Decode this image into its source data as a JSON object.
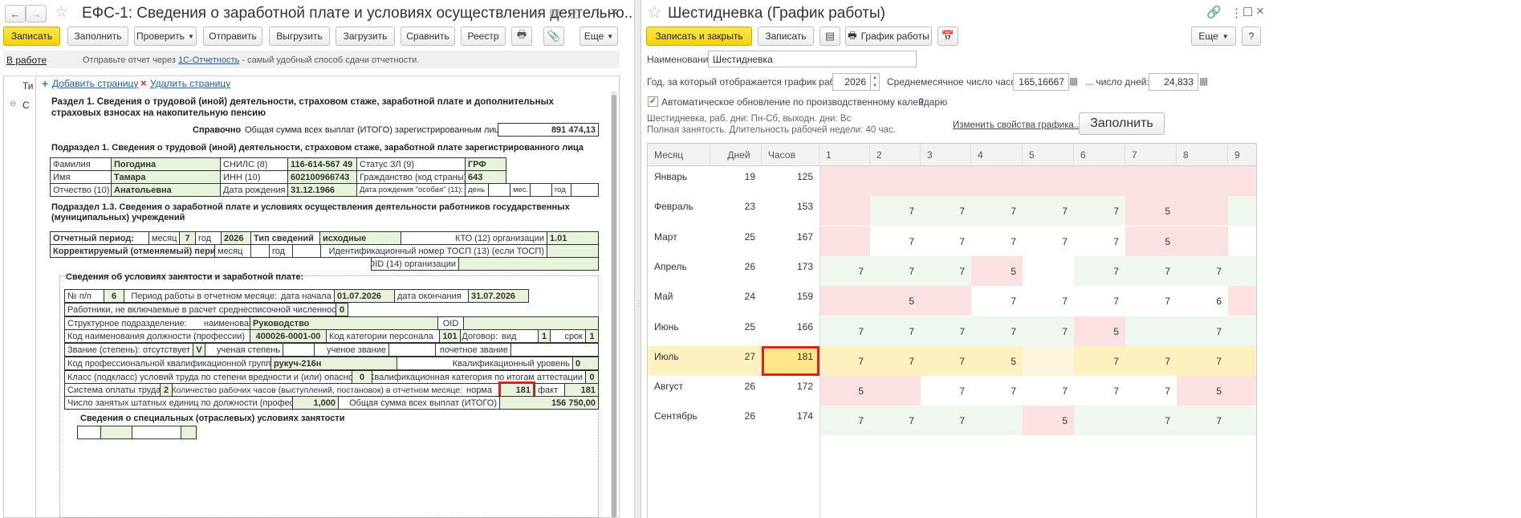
{
  "left": {
    "title": "ЕФС-1: Сведения о заработной плате и условиях осуществления деятельно...",
    "toolbar": {
      "save": "Записать",
      "fill": "Заполнить",
      "check": "Проверить",
      "send": "Отправить",
      "unload": "Выгрузить",
      "load": "Загрузить",
      "compare": "Сравнить",
      "registry": "Реестр",
      "more": "Еще"
    },
    "status": {
      "state": "В работе",
      "hint_pre": "Отправьте отчет через ",
      "hint_link": "1С-Отчетность",
      "hint_post": " - самый удобный способ сдачи отчетности."
    },
    "tree": {
      "t1": "Ти",
      "t2": "С"
    },
    "page_actions": {
      "add": "Добавить страницу",
      "remove": "Удалить страницу"
    },
    "form": {
      "section1": "Раздел 1. Сведения о трудовой (иной) деятельности, страховом стаже, заработной плате и дополнительных страховых взносах на накопительную пенсию",
      "ref": "Справочно",
      "total_label": "Общая сумма всех выплат (ИТОГО) зарегистрированным лицам",
      "total_value": "891 474,13",
      "sub1": "Подраздел 1. Сведения о трудовой (иной) деятельности, страховом стаже, заработной плате зарегистрированного лица",
      "surname_l": "Фамилия",
      "surname": "Погодина",
      "snils_l": "СНИЛС (8)",
      "snils": "116-614-567 49",
      "status_l": "Статус ЗЛ (9)",
      "status": "ГРФ",
      "name_l": "Имя",
      "name": "Тамара",
      "inn_l": "ИНН (10)",
      "inn": "602100966743",
      "citizen_l": "Гражданство (код страны)",
      "citizen": "643",
      "patr_l": "Отчество (10)",
      "patr": "Анатольевна",
      "dob_l": "Дата рождения",
      "dob": "31.12.1966",
      "dob_sp_l": "Дата рождения \"особая\" (11):",
      "day": "день",
      "mon": "мес.",
      "year": "год",
      "sub13": "Подраздел 1.3. Сведения о заработной плате и условиях осуществления деятельности работников государственных (муниципальных) учреждений",
      "period_l": "Отчетный период:",
      "month_l": "месяц",
      "month": "7",
      "year_l": "год",
      "year_v": "2026",
      "type_l": "Тип сведений",
      "type": "исходные",
      "kto_l": "КТО (12) организации",
      "kto": "1.01",
      "corr_l": "Корректируемый (отменяемый) период:",
      "corr_m": "месяц",
      "corr_y": "год",
      "tosp_l": "Идентификационный номер ТОСП (13) (если ТОСП)",
      "oid_l": "OID (14) организации",
      "cond_h": "Сведения об условиях занятости и заработной плате:",
      "np_l": "№ п/п",
      "np": "6",
      "work_l": "Период работы в отчетном месяце:",
      "start_l": "дата начала",
      "start": "01.07.2026",
      "end_l": "дата окончания",
      "end": "31.07.2026",
      "excl_l": "Работники, не включаемые в расчет среднесписочной численности",
      "excl": "0",
      "dept_l": "Структурное подразделение:",
      "dept_n": "наименование",
      "dept": "Руководство",
      "oid2": "OID",
      "pos_l": "Код наименования должности (профессии)",
      "pos": "400026-0001-00",
      "cat_l": "Код категории персонала",
      "cat": "101",
      "contract_l": "Договор:",
      "kind_l": "вид",
      "kind": "1",
      "term_l": "срок",
      "term": "1",
      "rank_l": "Звание (степень):",
      "absent_l": "отсутствует",
      "absent": "V",
      "deg_l": "ученая степень",
      "title_l": "ученое звание",
      "hon_l": "почетное звание",
      "pkg_l": "Код профессиональной квалификационной группы",
      "pkg": "рукуч-216н",
      "qlevel_l": "Квалификационный уровень",
      "qlevel": "0",
      "class_l": "Класс (подкласс) условий труда по степени вредности и (или) опасности",
      "class": "0",
      "qcat_l": "Квалификационная категория по итогам аттестации",
      "qcat": "0",
      "pay_l": "Система оплаты труда",
      "pay": "2",
      "hours_l": "Количество рабочих часов (выступлений, постановок) в отчетном месяце:",
      "norm_l": "норма",
      "norm": "181",
      "fact_l": "факт",
      "fact": "181",
      "units_l": "Число занятых штатных единиц по должности (профессии)",
      "units": "1,000",
      "sum_l": "Общая сумма всех выплат (ИТОГО)",
      "sum": "156 750,00",
      "special": "Сведения о специальных (отраслевых) условиях занятости"
    }
  },
  "right": {
    "title": "Шестидневка (График работы)",
    "toolbar": {
      "save_close": "Записать и закрыть",
      "save": "Записать",
      "schedule": "График работы",
      "more": "Еще",
      "help": "?"
    },
    "name_label": "Наименование:",
    "name_value": "Шестидневка",
    "year_label": "Год, за который отображается график работы:",
    "year_value": "2026",
    "avg_hours_label": "Среднемесячное число часов:",
    "avg_hours_value": "165,16667",
    "avg_days_label": "... число дней:",
    "avg_days_value": "24,833",
    "auto_label": "Автоматическое обновление по производственному календарю",
    "auto_q": "?",
    "desc1": "Шестидневка, раб. дни: Пн-Сб, выходн. дни: Вс",
    "desc2": "Полная занятость. Длительность рабочей недели: 40 час.",
    "change_link": "Изменить свойства графика...",
    "fill": "Заполнить",
    "grid": {
      "headers": [
        "Месяц",
        "Дней",
        "Часов",
        "1",
        "2",
        "3",
        "4",
        "5",
        "6",
        "7",
        "8",
        "9"
      ],
      "rows": [
        {
          "m": "Январь",
          "d": "19",
          "h": "125",
          "v": [
            "",
            "",
            "",
            "",
            "",
            "",
            "",
            "",
            ""
          ],
          "c": [
            "r",
            "r",
            "r",
            "r",
            "r",
            "r",
            "r",
            "r",
            "r"
          ]
        },
        {
          "m": "Февраль",
          "d": "23",
          "h": "153",
          "v": [
            "",
            "7",
            "7",
            "7",
            "7",
            "7",
            "5",
            "",
            ""
          ],
          "c": [
            "r",
            "g",
            "g",
            "g",
            "g",
            "g",
            "r",
            "r",
            "g"
          ]
        },
        {
          "m": "Март",
          "d": "25",
          "h": "167",
          "v": [
            "",
            "7",
            "7",
            "7",
            "7",
            "7",
            "5",
            "",
            ""
          ],
          "c": [
            "r",
            "w",
            "w",
            "w",
            "w",
            "w",
            "r",
            "r",
            "w"
          ]
        },
        {
          "m": "Апрель",
          "d": "26",
          "h": "173",
          "v": [
            "7",
            "7",
            "7",
            "5",
            "",
            "7",
            "7",
            "7",
            ""
          ],
          "c": [
            "g",
            "g",
            "g",
            "r",
            "w",
            "g",
            "g",
            "g",
            "g"
          ]
        },
        {
          "m": "Май",
          "d": "24",
          "h": "159",
          "v": [
            "",
            "5",
            "",
            "7",
            "7",
            "7",
            "7",
            "6",
            ""
          ],
          "c": [
            "r",
            "r",
            "r",
            "w",
            "w",
            "w",
            "w",
            "w",
            "r"
          ]
        },
        {
          "m": "Июнь",
          "d": "25",
          "h": "166",
          "v": [
            "7",
            "7",
            "7",
            "7",
            "7",
            "5",
            "",
            "7",
            ""
          ],
          "c": [
            "g",
            "g",
            "g",
            "g",
            "g",
            "r",
            "g",
            "g",
            "g"
          ]
        },
        {
          "m": "Июль",
          "d": "27",
          "h": "181",
          "v": [
            "7",
            "7",
            "7",
            "5",
            "",
            "7",
            "7",
            "7",
            ""
          ],
          "c": [
            "y",
            "y",
            "y",
            "y",
            "yl",
            "y",
            "y",
            "y",
            "y"
          ]
        },
        {
          "m": "Август",
          "d": "26",
          "h": "172",
          "v": [
            "5",
            "",
            "7",
            "7",
            "7",
            "7",
            "7",
            "5",
            ""
          ],
          "c": [
            "r",
            "r",
            "w",
            "w",
            "w",
            "w",
            "w",
            "r",
            "r"
          ]
        },
        {
          "m": "Сентябрь",
          "d": "26",
          "h": "174",
          "v": [
            "7",
            "7",
            "7",
            "",
            "5",
            "",
            "7",
            "7",
            ""
          ],
          "c": [
            "g",
            "g",
            "g",
            "g",
            "r",
            "g",
            "g",
            "g",
            "g"
          ]
        }
      ]
    }
  },
  "colors": {
    "accent": "#f5d20c",
    "red_cell": "#fbe1e1",
    "green_cell": "#f0f7ef",
    "yellow_cell": "#fdf1c0",
    "highlight": "#e02020",
    "link": "#1b5ea7"
  }
}
